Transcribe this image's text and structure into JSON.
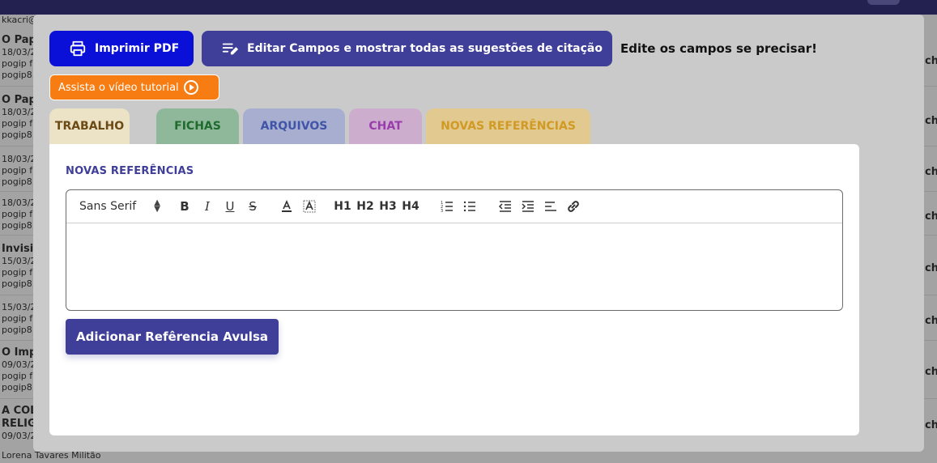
{
  "background": {
    "top_left_text": "kkacri@",
    "items": [
      {
        "title": "O Pap",
        "date": "18/03/2",
        "line1": "pogip f",
        "line2": "pogip8."
      },
      {
        "title": "O Pap",
        "date": "18/03/2",
        "line1": "pogip f",
        "line2": "pogip8."
      },
      {
        "title": "",
        "date": "18/03/2",
        "line1": "pogip f",
        "line2": "pogip8."
      },
      {
        "title": "",
        "date": "18/03/2",
        "line1": "pogip f",
        "line2": "pogip8."
      },
      {
        "title": "Invisil",
        "date": "15/03/2",
        "line1": "pogip f",
        "line2": "pogip8."
      },
      {
        "title": "",
        "date": "15/03/2",
        "line1": "pogip f",
        "line2": "pogip8."
      },
      {
        "title": "O Imp",
        "date": "09/03/2",
        "line1": "pogip f",
        "line2": "pogip8."
      },
      {
        "title": "A COL",
        "title2": "RELIG",
        "date": "09/03/2",
        "line1": "",
        "line2": ""
      }
    ],
    "right_fragment": "ch",
    "bottom_name": "Lorena Tavares Militão"
  },
  "modal": {
    "print_button": "Imprimir PDF",
    "edit_button": "Editar Campos e mostrar todas as sugestões de citação",
    "hint": "Edite os campos se precisar!",
    "video_button": "Assista o vídeo tutorial",
    "tabs": [
      {
        "label": "TRABALHO"
      },
      {
        "label": "FICHAS"
      },
      {
        "label": "ARQUIVOS"
      },
      {
        "label": "CHAT"
      },
      {
        "label": "NOVAS REFERÊNCIAS"
      }
    ],
    "panel_title": "NOVAS REFERÊNCIAS",
    "editor": {
      "font": "Sans Serif",
      "toolbar": [
        "bold-icon",
        "italic-icon",
        "underline-icon",
        "strikethrough-icon",
        "text-color-icon",
        "background-color-icon",
        "h1-icon",
        "h2-icon",
        "h3-icon",
        "h4-icon",
        "ordered-list-icon",
        "bullet-list-icon",
        "outdent-icon",
        "indent-icon",
        "align-icon",
        "link-icon"
      ],
      "heading_labels": {
        "h1": "H1",
        "h2": "H2",
        "h3": "H3",
        "h4": "H4"
      },
      "content": ""
    },
    "add_button": "Adicionar Refêrencia Avulsa"
  },
  "colors": {
    "primary": "#3f3e98",
    "print_blue": "#0a10d8",
    "orange": "#f77c12"
  }
}
